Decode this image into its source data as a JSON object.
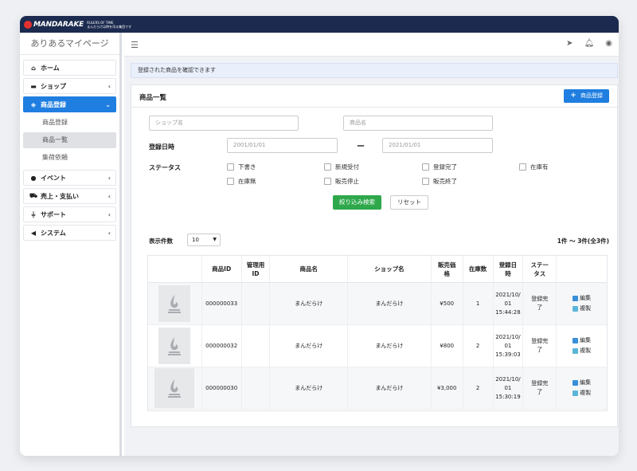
{
  "brand": {
    "name": "MANDARAKE",
    "tagline_1": "RULERS OF TIME",
    "tagline_2": "まんだらけは時を司る集団です"
  },
  "sidebar": {
    "title": "ありあるマイページ",
    "items": [
      {
        "label": "ホーム",
        "icon": "home-icon"
      },
      {
        "label": "ショップ",
        "icon": "store-icon"
      },
      {
        "label": "商品登録",
        "icon": "box-icon"
      },
      {
        "label": "イベント",
        "icon": "info-icon"
      },
      {
        "label": "売上・支払い",
        "icon": "cart-icon"
      },
      {
        "label": "サポート",
        "icon": "plug-icon"
      },
      {
        "label": "システム",
        "icon": "megaphone-icon"
      }
    ],
    "submenu": [
      {
        "label": "商品登録"
      },
      {
        "label": "商品一覧"
      },
      {
        "label": "集荷依頼"
      }
    ]
  },
  "notice": "登録された商品を確認できます",
  "card": {
    "title": "商品一覧",
    "add_label": "商品登録"
  },
  "filters": {
    "shop_placeholder": "ショップ名",
    "product_placeholder": "商品名",
    "date_label": "登録日時",
    "date_from": "2001/01/01",
    "date_sep": "ー",
    "date_to": "2021/01/01",
    "status_label": "ステータス",
    "statuses": [
      "下書き",
      "新規受付",
      "登録完了",
      "在庫有",
      "在庫無",
      "販売停止",
      "販売終了"
    ],
    "search_label": "絞り込み検索",
    "reset_label": "リセット"
  },
  "pagination": {
    "per_page_label": "表示件数",
    "per_page_value": "10",
    "range_text": "1件 〜 3件(全3件)"
  },
  "table": {
    "headers": [
      "商品ID",
      "管理用\nID",
      "商品名",
      "ショップ名",
      "販売価\n格",
      "在庫数",
      "登録日\n時",
      "ステー\nタス"
    ],
    "rows": [
      {
        "id": "000000033",
        "name": "まんだらけ",
        "shop": "まんだらけ",
        "price": "¥500",
        "stock": "1",
        "date": "2021/10/\n01\n15:44:28",
        "status": "登録完\n了",
        "edit": "編集",
        "copy": "複製"
      },
      {
        "id": "000000032",
        "name": "まんだらけ",
        "shop": "まんだらけ",
        "price": "¥800",
        "stock": "2",
        "date": "2021/10/\n01\n15:39:03",
        "status": "登録完\n了",
        "edit": "編集",
        "copy": "複製"
      },
      {
        "id": "000000030",
        "name": "まんだらけ",
        "shop": "まんだらけ",
        "price": "¥3,000",
        "stock": "2",
        "date": "2021/10/\n01\n15:30:19",
        "status": "登録完\n了",
        "edit": "編集",
        "copy": "複製"
      }
    ]
  }
}
